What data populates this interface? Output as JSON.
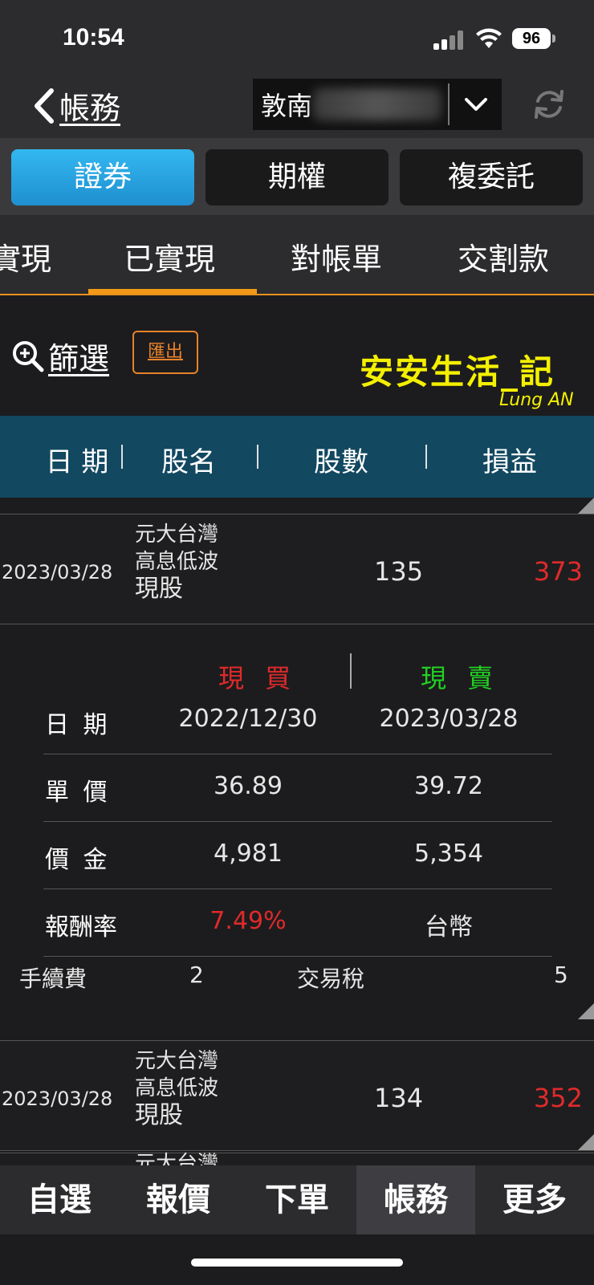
{
  "status": {
    "time": "10:54",
    "battery": "96"
  },
  "nav": {
    "back_label": "帳務",
    "account_name": "敦南"
  },
  "segments": [
    {
      "label": "證券",
      "active": true
    },
    {
      "label": "期權",
      "active": false
    },
    {
      "label": "複委託",
      "active": false
    }
  ],
  "tabs": [
    "實現",
    "已實現",
    "對帳單",
    "交割款"
  ],
  "filter": {
    "label": "篩選",
    "export_label": "匯出"
  },
  "watermark": {
    "title": "安安生活_記",
    "subtitle": "Lung AN"
  },
  "columns": [
    "日 期",
    "股名",
    "股數",
    "損益"
  ],
  "rows": [
    {
      "date": "2023/03/28",
      "name_lines": [
        "元大台灣",
        "高息低波",
        "現股"
      ],
      "qty": "135",
      "pl": "373"
    },
    {
      "date": "2023/03/28",
      "name_lines": [
        "元大台灣",
        "高息低波",
        "現股"
      ],
      "qty": "134",
      "pl": "352"
    }
  ],
  "partial_row_name": "元大台灣",
  "detail": {
    "buy_label": "現 買",
    "sell_label": "現 賣",
    "buy_color": "#e02a2a",
    "sell_color": "#22d022",
    "rows": [
      {
        "label": "日 期",
        "buy": "2022/12/30",
        "sell": "2023/03/28"
      },
      {
        "label": "單 價",
        "buy": "36.89",
        "sell": "39.72"
      },
      {
        "label": "價 金",
        "buy": "4,981",
        "sell": "5,354"
      },
      {
        "label": "報酬率",
        "buy": "7.49%",
        "sell": "台幣"
      }
    ],
    "fee_label": "手續費",
    "fee_value": "2",
    "tax_label": "交易稅",
    "tax_value": "5"
  },
  "bottom_nav": [
    {
      "label": "自選",
      "active": false
    },
    {
      "label": "報價",
      "active": false
    },
    {
      "label": "下單",
      "active": false
    },
    {
      "label": "帳務",
      "active": true
    },
    {
      "label": "更多",
      "active": false
    }
  ]
}
